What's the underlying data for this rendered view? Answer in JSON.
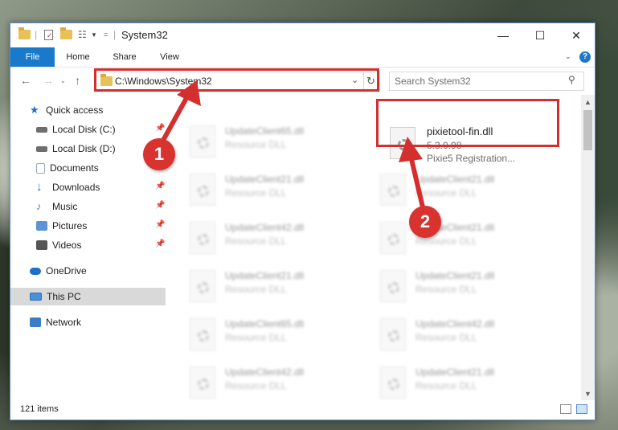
{
  "window": {
    "title": "System32",
    "controls": {
      "minimize": "—",
      "maximize": "☐",
      "close": "✕"
    },
    "help_icon": "help-icon"
  },
  "ribbon": {
    "tabs": [
      {
        "label": "File",
        "active": true
      },
      {
        "label": "Home"
      },
      {
        "label": "Share"
      },
      {
        "label": "View"
      }
    ],
    "expand_icon": "chevron-down-icon"
  },
  "address": {
    "path": "C:\\Windows\\System32",
    "search_placeholder": "Search System32"
  },
  "sidebar": {
    "items": [
      {
        "label": "Quick access",
        "icon": "star-icon",
        "color": "#1a73c9"
      },
      {
        "label": "Local Disk (C:)",
        "icon": "drive-icon",
        "color": "#6e6e6e",
        "pinned": true
      },
      {
        "label": "Local Disk (D:)",
        "icon": "drive-icon",
        "color": "#6e6e6e",
        "pinned": true
      },
      {
        "label": "Documents",
        "icon": "documents-icon",
        "color": "#9aa7b8",
        "pinned": true
      },
      {
        "label": "Downloads",
        "icon": "downloads-icon",
        "color": "#1b76d1",
        "pinned": true
      },
      {
        "label": "Music",
        "icon": "music-icon",
        "color": "#4a7ec2",
        "pinned": true
      },
      {
        "label": "Pictures",
        "icon": "pictures-icon",
        "color": "#5b93d4",
        "pinned": true
      },
      {
        "label": "Videos",
        "icon": "videos-icon",
        "color": "#555555",
        "pinned": true
      },
      {
        "label": "OneDrive",
        "icon": "cloud-icon",
        "color": "#1e6fc7"
      },
      {
        "label": "This PC",
        "icon": "computer-icon",
        "color": "#4a90d9",
        "selected": true
      },
      {
        "label": "Network",
        "icon": "network-icon",
        "color": "#3b7dc4"
      }
    ]
  },
  "files": {
    "highlighted": {
      "name": "pixietool-fin.dll",
      "version": "5.3.0.98",
      "description": "Pixie5 Registration..."
    },
    "left_column": [
      {
        "name": "UpdateClient65.dll",
        "type": "Resource DLL"
      },
      {
        "name": "UpdateClient21.dll",
        "type": "Resource DLL"
      },
      {
        "name": "UpdateClient42.dll",
        "type": "Resource DLL"
      },
      {
        "name": "UpdateClient21.dll",
        "type": "Resource DLL"
      },
      {
        "name": "UpdateClient65.dll",
        "type": "Resource DLL"
      },
      {
        "name": "UpdateClient42.dll",
        "type": "Resource DLL"
      }
    ],
    "right_column": [
      {
        "name": "UpdateClient21.dll",
        "type": "Resource DLL"
      },
      {
        "name": "UpdateClient21.dll",
        "type": "Resource DLL"
      },
      {
        "name": "UpdateClient21.dll",
        "type": "Resource DLL"
      },
      {
        "name": "UpdateClient42.dll",
        "type": "Resource DLL"
      },
      {
        "name": "UpdateClient21.dll",
        "type": "Resource DLL"
      }
    ]
  },
  "status": {
    "item_count": "121 items"
  },
  "annotations": [
    {
      "number": "1",
      "color": "#d9332f"
    },
    {
      "number": "2",
      "color": "#d9332f"
    }
  ]
}
